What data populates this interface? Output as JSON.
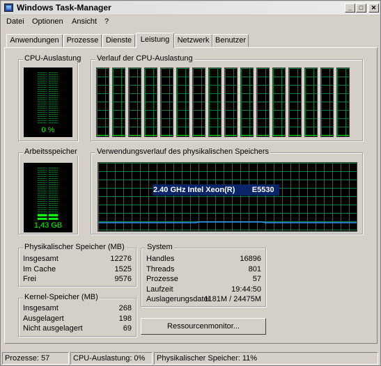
{
  "window": {
    "title": "Windows Task-Manager"
  },
  "menu": [
    "Datei",
    "Optionen",
    "Ansicht",
    "?"
  ],
  "tabs": [
    {
      "label": "Anwendungen",
      "active": false
    },
    {
      "label": "Prozesse",
      "active": false
    },
    {
      "label": "Dienste",
      "active": false
    },
    {
      "label": "Leistung",
      "active": true
    },
    {
      "label": "Netzwerk",
      "active": false
    },
    {
      "label": "Benutzer",
      "active": false
    }
  ],
  "cpu": {
    "usage_title": "CPU-Auslastung",
    "usage_value": "0 %",
    "usage_percent": 0,
    "history_title": "Verlauf der CPU-Auslastung",
    "core_count": 16
  },
  "memory": {
    "title": "Arbeitsspeicher",
    "value": "1,43 GB",
    "history_title": "Verwendungsverlauf des physikalischen Speichers",
    "overlay_text": "2.40 GHz Intel Xeon(R)        E5530"
  },
  "physical_memory": {
    "title": "Physikalischer Speicher (MB)",
    "rows": [
      {
        "label": "Insgesamt",
        "value": "12276"
      },
      {
        "label": "Im Cache",
        "value": "1525"
      },
      {
        "label": "Frei",
        "value": "9576"
      }
    ]
  },
  "kernel_memory": {
    "title": "Kernel-Speicher (MB)",
    "rows": [
      {
        "label": "Insgesamt",
        "value": "268"
      },
      {
        "label": "Ausgelagert",
        "value": "198"
      },
      {
        "label": "Nicht ausgelagert",
        "value": "69"
      }
    ]
  },
  "system": {
    "title": "System",
    "rows": [
      {
        "label": "Handles",
        "value": "16896"
      },
      {
        "label": "Threads",
        "value": "801"
      },
      {
        "label": "Prozesse",
        "value": "57"
      },
      {
        "label": "Laufzeit",
        "value": "19:44:50"
      },
      {
        "label": "Auslagerungsdatei",
        "value": "1181M / 24475M"
      }
    ]
  },
  "resource_monitor_button": "Ressourcenmonitor...",
  "status": {
    "processes": "Prozesse: 57",
    "cpu": "CPU-Auslastung: 0%",
    "memory": "Physikalischer Speicher: 11%"
  },
  "colors": {
    "meter_green": "#00ff00",
    "grid_green": "#008040",
    "memory_line": "#3399ff",
    "selection_blue": "#0a246a"
  }
}
